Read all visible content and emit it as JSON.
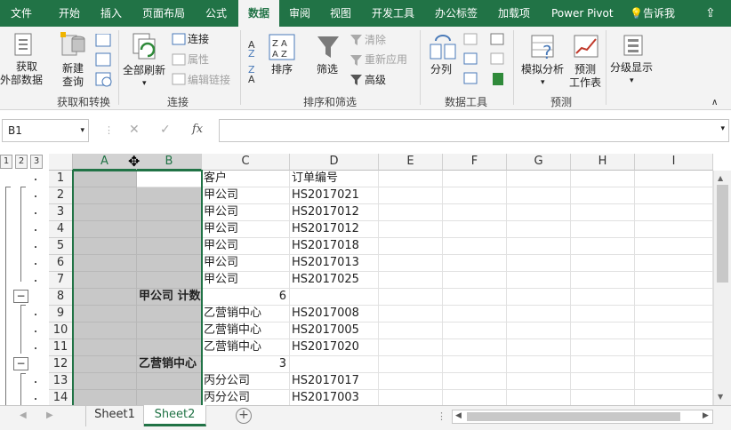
{
  "tabs": [
    "文件",
    "开始",
    "插入",
    "页面布局",
    "公式",
    "数据",
    "审阅",
    "视图",
    "开发工具",
    "办公标签",
    "加载项",
    "Power Pivot",
    "告诉我"
  ],
  "active_tab": "数据",
  "ribbon": {
    "get_external": [
      "获取",
      "外部数据"
    ],
    "new_query": [
      "新建",
      "查询"
    ],
    "refresh_all": "全部刷新",
    "connections": "连接",
    "properties": "属性",
    "edit_links": "编辑链接",
    "sort": "排序",
    "filter": "筛选",
    "clear": "清除",
    "reapply": "重新应用",
    "advanced": "高级",
    "text_to_columns": "分列",
    "what_if": "模拟分析",
    "forecast": [
      "预测",
      "工作表"
    ],
    "outline": "分级显示",
    "groups": [
      "获取和转换",
      "连接",
      "排序和筛选",
      "数据工具",
      "预测"
    ]
  },
  "namebox": "B1",
  "fx": "fx",
  "outline_levels": [
    "1",
    "2",
    "3"
  ],
  "columns": [
    "A",
    "B",
    "C",
    "D",
    "E",
    "F",
    "G",
    "H",
    "I"
  ],
  "rows": [
    {
      "n": "1",
      "b": "",
      "c": "客户",
      "d": "订单编号"
    },
    {
      "n": "2",
      "b": "",
      "c": "甲公司",
      "d": "HS2017021"
    },
    {
      "n": "3",
      "b": "",
      "c": "甲公司",
      "d": "HS2017012"
    },
    {
      "n": "4",
      "b": "",
      "c": "甲公司",
      "d": "HS2017012"
    },
    {
      "n": "5",
      "b": "",
      "c": "甲公司",
      "d": "HS2017018"
    },
    {
      "n": "6",
      "b": "",
      "c": "甲公司",
      "d": "HS2017013"
    },
    {
      "n": "7",
      "b": "",
      "c": "甲公司",
      "d": "HS2017025"
    },
    {
      "n": "8",
      "b": "甲公司 计数",
      "c": "6",
      "d": ""
    },
    {
      "n": "9",
      "b": "",
      "c": "乙营销中心",
      "d": "HS2017008"
    },
    {
      "n": "10",
      "b": "",
      "c": "乙营销中心",
      "d": "HS2017005"
    },
    {
      "n": "11",
      "b": "",
      "c": "乙营销中心",
      "d": "HS2017020"
    },
    {
      "n": "12",
      "b": "乙营销中心 计数",
      "c": "3",
      "d": ""
    },
    {
      "n": "13",
      "b": "",
      "c": "丙分公司",
      "d": "HS2017017"
    },
    {
      "n": "14",
      "b": "",
      "c": "丙分公司",
      "d": "HS2017003"
    }
  ],
  "sheets": [
    "Sheet1",
    "Sheet2"
  ],
  "active_sheet": "Sheet2",
  "colors": {
    "accent": "#217346"
  }
}
